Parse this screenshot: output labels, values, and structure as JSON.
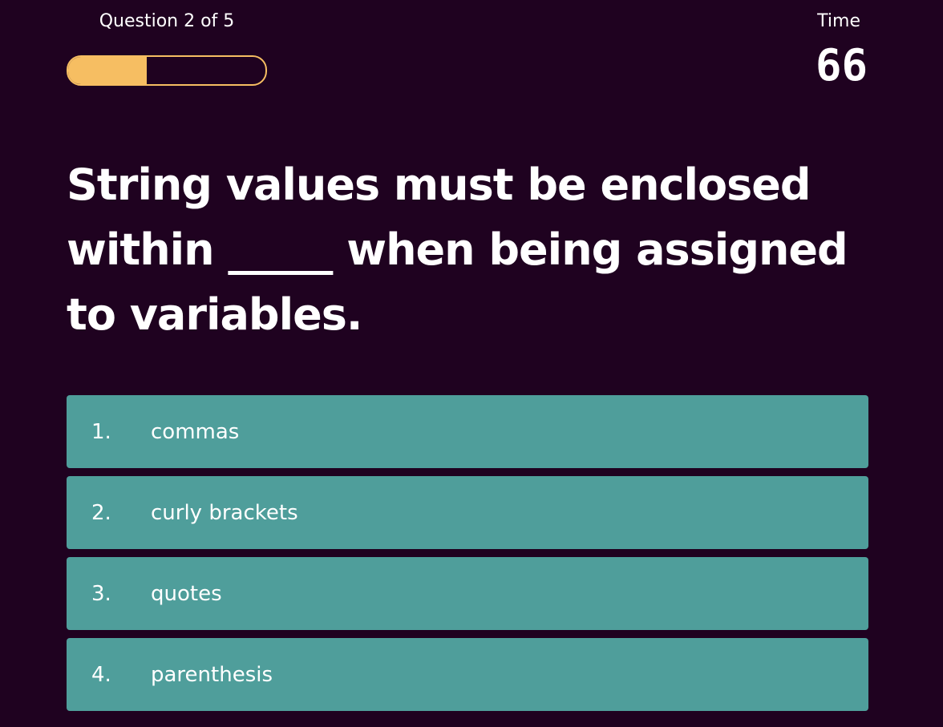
{
  "header": {
    "question_counter": "Question 2 of 5",
    "progress_percent": 40,
    "time_label": "Time",
    "time_value": "66"
  },
  "question": {
    "text": "String values must be enclosed within _____ when being assigned to variables."
  },
  "answers": [
    {
      "number": "1.",
      "label": "commas"
    },
    {
      "number": "2.",
      "label": "curly brackets"
    },
    {
      "number": "3.",
      "label": "quotes"
    },
    {
      "number": "4.",
      "label": "parenthesis"
    }
  ],
  "colors": {
    "background": "#1f0220",
    "accent": "#f6be62",
    "answer": "#4f9e9b"
  }
}
